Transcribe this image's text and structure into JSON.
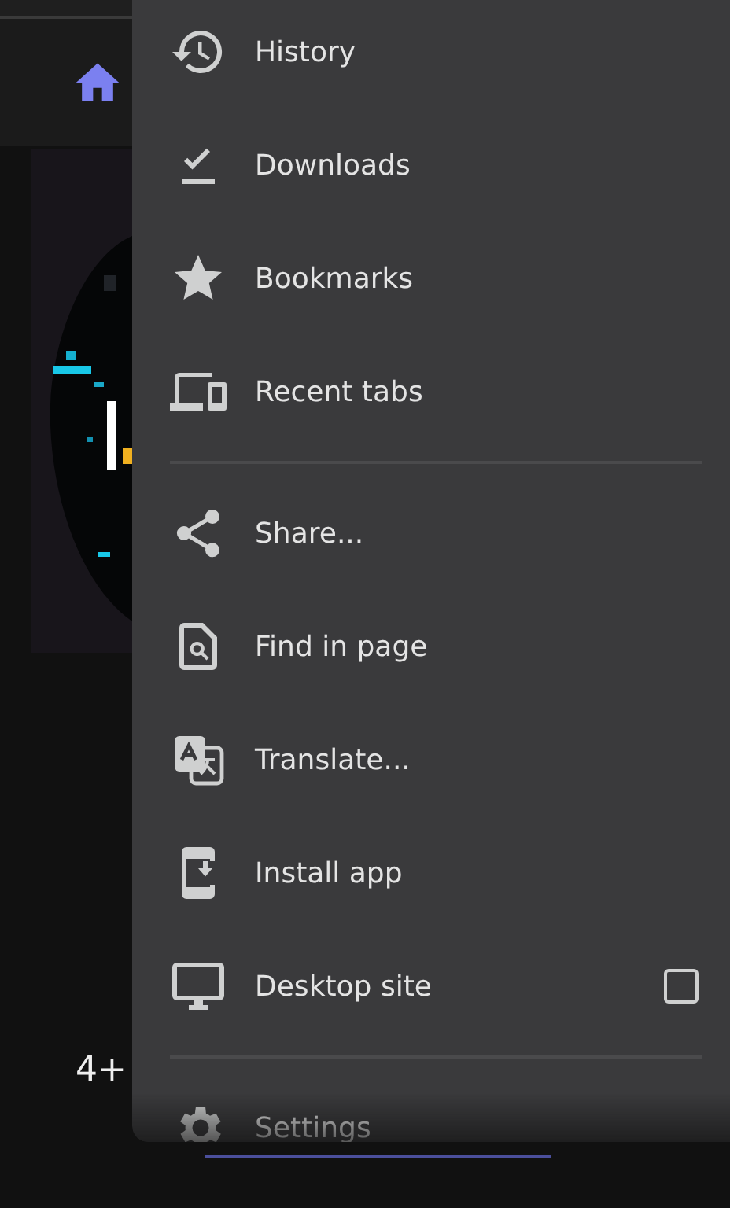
{
  "page": {
    "badge": "4+"
  },
  "menu": {
    "items": [
      {
        "kind": "item",
        "label": "History"
      },
      {
        "kind": "item",
        "label": "Downloads"
      },
      {
        "kind": "item",
        "label": "Bookmarks"
      },
      {
        "kind": "item",
        "label": "Recent tabs"
      },
      {
        "kind": "divider"
      },
      {
        "kind": "item",
        "label": "Share..."
      },
      {
        "kind": "item",
        "label": "Find in page"
      },
      {
        "kind": "item",
        "label": "Translate..."
      },
      {
        "kind": "item",
        "label": "Install app"
      },
      {
        "kind": "checkbox",
        "label": "Desktop site",
        "checked": false
      },
      {
        "kind": "divider"
      },
      {
        "kind": "item",
        "label": "Settings"
      }
    ]
  }
}
